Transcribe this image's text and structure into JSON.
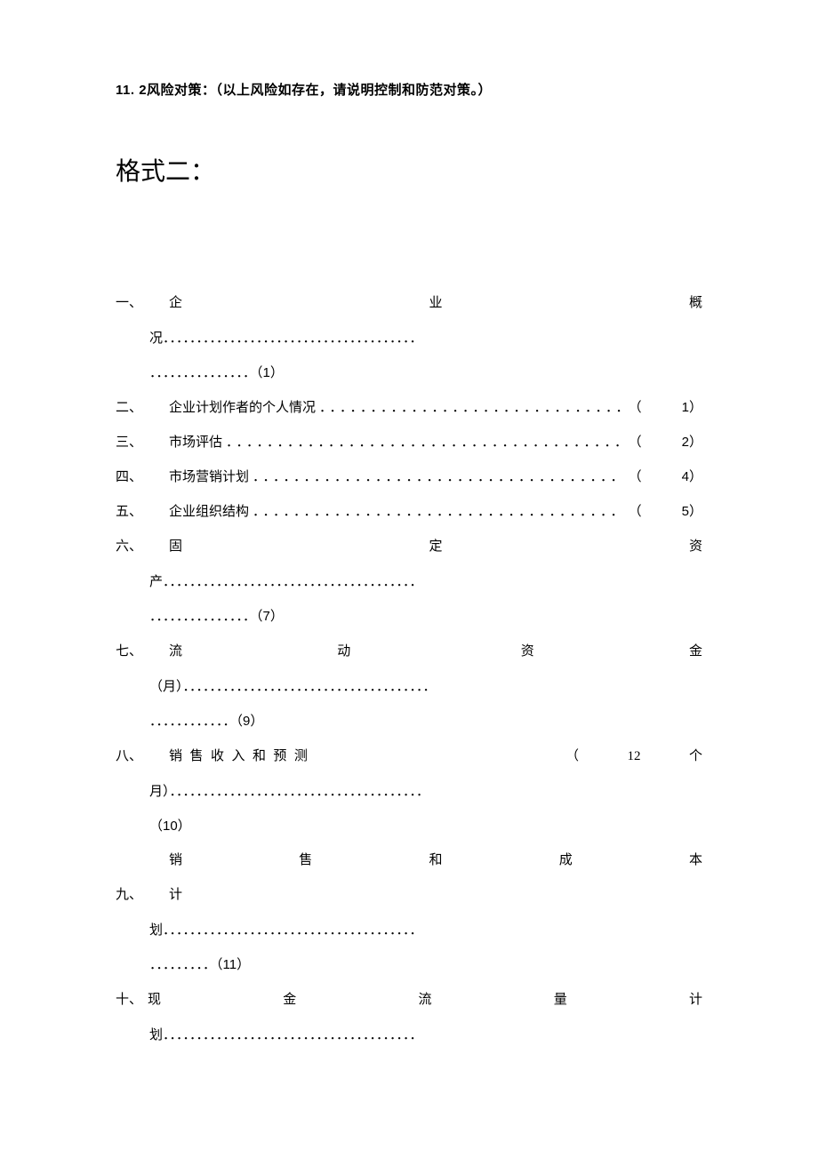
{
  "section11": "11. 2风险对策：（以上风险如存在，请说明控制和防范对策。）",
  "heading": "格式二：",
  "toc": {
    "item1": {
      "num": "一、",
      "justified": "企　　　　　　　　　　　　　　　　业　　　　　　　　　　　　　　　　概",
      "cont1": "况．．．．．．．．．．．．．．．．．．．．．．．．．．．．．．．．．．．．．．",
      "cont2": "．．．．．．．．．．．．．．．（1）"
    },
    "item2": {
      "num": "二、",
      "label": "企业计划作者的个人情况",
      "dots": "．．．．．．．．．．．．．．．．．．．．．．．．．．．．．．．．．．．．．．",
      "page": "（　　　1）"
    },
    "item3": {
      "num": "三、",
      "label": "市场评估",
      "dots": "．．．．．．．．．．．．．．．．．．．．．．．．．．．．．．．．．．．．．．．．．．．．．．．．．．．",
      "page": "（　　　2）"
    },
    "item4": {
      "num": "四、",
      "label": "市场营销计划",
      "dots": "．．．．．．．．．．．．．．．．．．．．．．．．．．．．．．．．．．．．．．．．．．．．．．．",
      "page": "（　　　4）"
    },
    "item5": {
      "num": "五、",
      "label": "企业组织结构",
      "dots": "．．．．．．．．．．．．．．．．．．．．．．．．．．．．．．．．．．．．．．．．．．．．．．．",
      "page": "（　　　5）"
    },
    "item6": {
      "num": "六、",
      "justified": "固　　　　　　　　　　　　　　　　定　　　　　　　　　　　　　　　　资",
      "cont1": "产．．．．．．．．．．．．．．．．．．．．．．．．．．．．．．．．．．．．．．",
      "cont2": "．．．．．．．．．．．．．．．（7）"
    },
    "item7": {
      "num": "七、",
      "justified": "流　　　　　　　　　　动　　　　　　　　　　　资　　　　　　　　　　金",
      "cont1": "（月）．．．．．．．．．．．．．．．．．．．．．．．．．．．．．．．．．．．．．",
      "cont2": "．．．．．．．．．．．．（9）"
    },
    "item8": {
      "num": "八、",
      "justified": "销 售 收 入 和 预 测　　　　　　　　　　　　　　　　　（　　　12　　　个",
      "cont1": "月）．．．．．．．．．．．．．．．．．．．．．．．．．．．．．．．．．．．．．．",
      "cont2": "（10）"
    },
    "item9": {
      "num": "九、",
      "justified": "销　　　　　　　售　　　　　　　和　　　　　　　成　　　　　　　本　　　　　　　计",
      "cont1": "划．．．．．．．．．．．．．．．．．．．．．．．．．．．．．．．．．．．．．．",
      "cont2": "．．．．．．．．．（11）"
    },
    "item10": {
      "num": "十、",
      "justified": "现　　　　　　　　金　　　　　　　　流　　　　　　　　量　　　　　　　　计",
      "cont1": "划．．．．．．．．．．．．．．．．．．．．．．．．．．．．．．．．．．．．．．"
    }
  }
}
